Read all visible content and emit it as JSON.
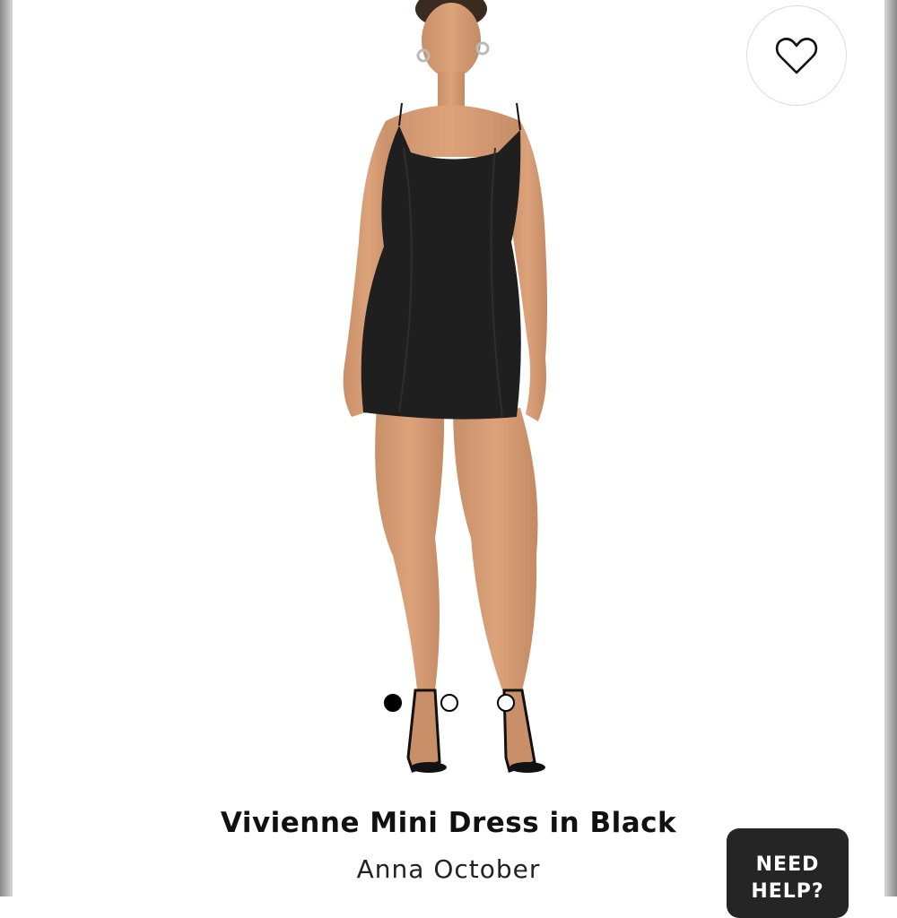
{
  "product": {
    "title": "Vivienne Mini Dress in Black",
    "brand": "Anna October",
    "image_alt": "Model wearing a black mini slip dress"
  },
  "carousel": {
    "total": 3,
    "active_index": 0
  },
  "wishlist": {
    "icon": "heart-outline-icon"
  },
  "help": {
    "label": "NEED HELP?"
  },
  "colors": {
    "background": "#ffffff",
    "dress": "#1f1f1f",
    "help_button_bg": "#252525"
  }
}
